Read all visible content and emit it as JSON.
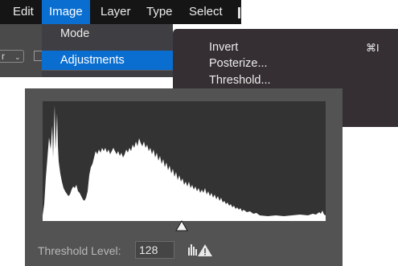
{
  "menubar": {
    "items": [
      {
        "label": "Edit"
      },
      {
        "label": "Image"
      },
      {
        "label": "Layer"
      },
      {
        "label": "Type"
      },
      {
        "label": "Select"
      }
    ],
    "active_index": 1
  },
  "image_menu": {
    "items": [
      {
        "label": "Mode"
      },
      {
        "label": "Adjustments"
      }
    ],
    "highlighted_index": 1
  },
  "adjustments_submenu": {
    "items": [
      {
        "label": "Invert",
        "shortcut": "⌘I"
      },
      {
        "label": "Posterize..."
      },
      {
        "label": "Threshold..."
      }
    ]
  },
  "threshold_dialog": {
    "level_label": "Threshold Level:",
    "level_value": "128",
    "level_fraction": 0.5,
    "warning_icon": "histogram-warning-icon"
  },
  "colors": {
    "menubar": "#151515",
    "highlight": "#0a6ed1",
    "submenu_bg": "#352f33",
    "dialog_bg": "#535353",
    "histogram_bg": "#333333"
  }
}
